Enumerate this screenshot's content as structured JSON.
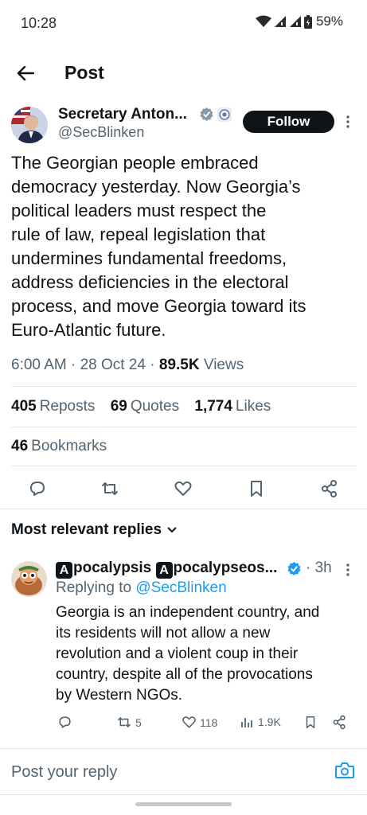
{
  "status_bar": {
    "time": "10:28",
    "battery": "59%"
  },
  "header": {
    "title": "Post"
  },
  "author": {
    "name": "Secretary Anton...",
    "handle": "@SecBlinken",
    "follow_label": "Follow"
  },
  "tweet": {
    "lines": [
      "The Georgian people embraced",
      "democracy yesterday. Now Georgia’s",
      "political leaders must respect the",
      "rule of law, repeal legislation that",
      "undermines fundamental freedoms,",
      "address deficiencies in the electoral",
      "process, and move Georgia toward its",
      "Euro-Atlantic future."
    ],
    "time": "6:00 AM",
    "date": "28 Oct 24",
    "views_count": "89.5K",
    "views_label": "Views"
  },
  "stats": {
    "reposts_count": "405",
    "reposts_label": "Reposts",
    "quotes_count": "69",
    "quotes_label": "Quotes",
    "likes_count": "1,774",
    "likes_label": "Likes",
    "bookmarks_count": "46",
    "bookmarks_label": "Bookmarks"
  },
  "replies": {
    "header": "Most relevant replies",
    "items": [
      {
        "name_part1": "pocalypsis",
        "name_part2": "pocalypseos...",
        "box_letter": "A",
        "time": "3h",
        "replying_prefix": "Replying to",
        "replying_handle": "@SecBlinken",
        "lines": [
          "Georgia is an independent country, and",
          "its residents will not allow a new",
          "revolution and a violent coup in their",
          "country, despite all of the provocations",
          "by Western NGOs."
        ],
        "reposts": "5",
        "likes": "118",
        "views": "1.9K"
      }
    ]
  },
  "composer": {
    "placeholder": "Post your reply"
  },
  "colors": {
    "accent": "#1d9bf0",
    "text": "#0f1419",
    "secondary": "#536471"
  },
  "icons": [
    "back-arrow-icon",
    "verified-icon",
    "affiliation-icon",
    "more-icon",
    "reply-icon",
    "repost-icon",
    "like-icon",
    "bookmark-icon",
    "share-icon",
    "chevron-down-icon",
    "views-icon",
    "camera-icon"
  ]
}
